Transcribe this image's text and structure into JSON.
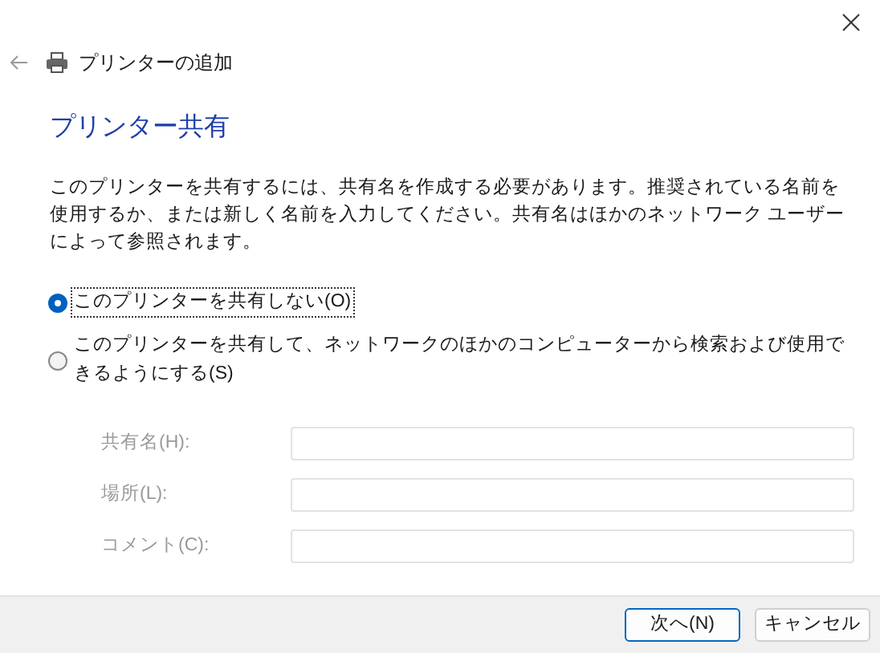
{
  "window": {
    "title": "プリンターの追加"
  },
  "heading": "プリンター共有",
  "description": "このプリンターを共有するには、共有名を作成する必要があります。推奨されている名前を使用するか、または新しく名前を入力してください。共有名はほかのネットワーク ユーザーによって参照されます。",
  "options": [
    {
      "label": "このプリンターを共有しない(O)",
      "selected": true
    },
    {
      "label": "このプリンターを共有して、ネットワークのほかのコンピューターから検索および使用できるようにする(S)",
      "selected": false
    }
  ],
  "fields": [
    {
      "label": "共有名(H):",
      "disabled": true
    },
    {
      "label": "場所(L):",
      "disabled": true
    },
    {
      "label": "コメント(C):",
      "disabled": true
    }
  ],
  "buttons": [
    {
      "label": "次へ(N)",
      "kind": "primary"
    },
    {
      "label": "キャンセル",
      "kind": "secondary"
    }
  ]
}
